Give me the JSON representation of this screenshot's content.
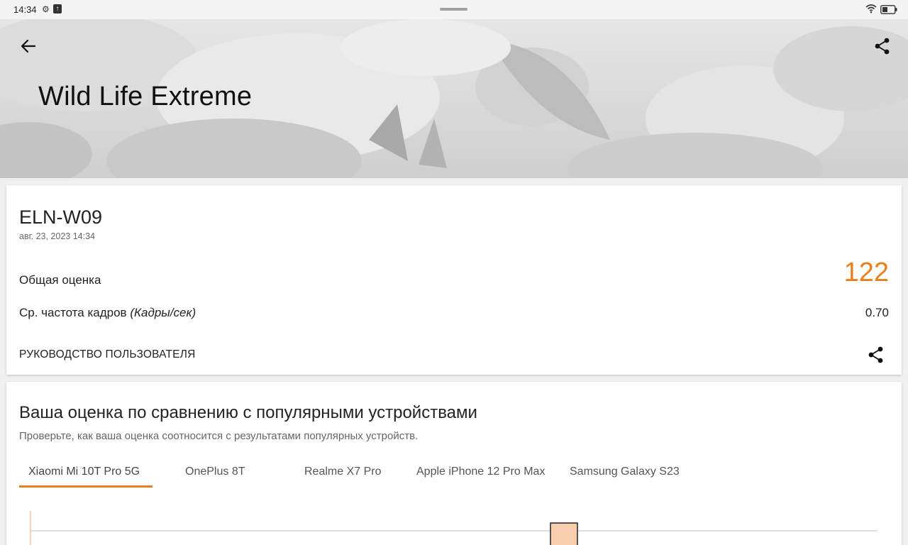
{
  "status_bar": {
    "time": "14:34"
  },
  "hero": {
    "title": "Wild Life Extreme"
  },
  "result": {
    "device_name": "ELN-W09",
    "date": "авг. 23, 2023 14:34",
    "score_label": "Общая оценка",
    "score_value": "122",
    "fps_label": "Ср. частота кадров",
    "fps_unit": "(Кадры/сек)",
    "fps_value": "0.70",
    "guide_label": "РУКОВОДСТВО ПОЛЬЗОВАТЕЛЯ"
  },
  "compare": {
    "title": "Ваша оценка по сравнению с популярными устройствами",
    "subtitle": "Проверьте, как ваша оценка соотносится с результатами популярных устройств.",
    "tabs": [
      {
        "label": "Xiaomi Mi 10T Pro 5G",
        "active": true
      },
      {
        "label": "OnePlus 8T",
        "active": false
      },
      {
        "label": "Realme X7 Pro",
        "active": false
      },
      {
        "label": "Apple iPhone 12 Pro Max",
        "active": false
      },
      {
        "label": "Samsung Galaxy S23",
        "active": false
      }
    ]
  },
  "colors": {
    "accent": "#e8801e",
    "bar_fill": "#f7cfae"
  }
}
